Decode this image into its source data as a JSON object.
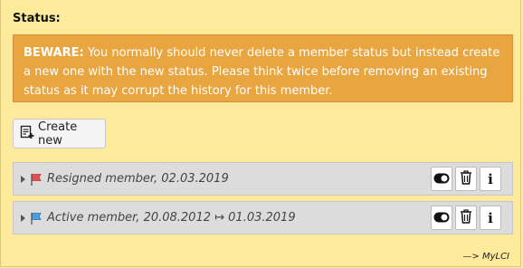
{
  "section": {
    "title": "Status:"
  },
  "warning": {
    "prefix": "BEWARE:",
    "text": " You normally should never delete a member status but instead create a new one with the new status. Please think twice before removing an existing status as it may corrupt the history for this member."
  },
  "toolbar": {
    "create_label": "Create new",
    "create_icon": "add-document-icon"
  },
  "statuses": [
    {
      "label": "Resigned member, 02.03.2019",
      "flag_color": "#e0544f",
      "flag_icon": "red-flag-icon"
    },
    {
      "label": "Active member, 20.08.2012 ↦ 01.03.2019",
      "flag_color": "#4f9fe0",
      "flag_icon": "blue-flag-icon"
    }
  ],
  "actions": {
    "toggle_icon": "toggle-icon",
    "delete_icon": "trash-icon",
    "info_glyph": "i"
  },
  "footer": {
    "link_text": "—> MyLCI"
  }
}
